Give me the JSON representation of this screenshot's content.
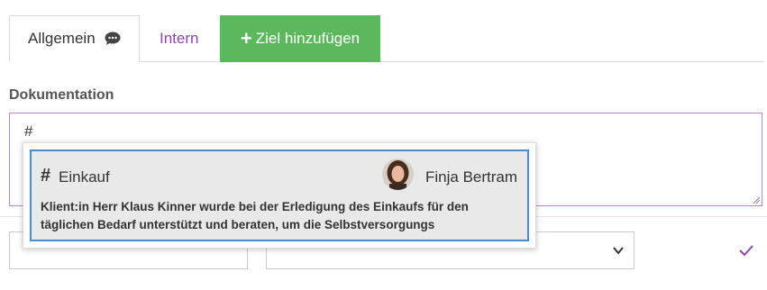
{
  "tabs": {
    "general": "Allgemein",
    "internal": "Intern",
    "add_goal": "Ziel hinzufügen",
    "add_symbol": "+"
  },
  "documentation": {
    "label": "Dokumentation",
    "value": "#"
  },
  "suggestion": {
    "hash": "#",
    "tag": "Einkauf",
    "user": "Finja Bertram",
    "text": "Klient:in Herr Klaus Kinner wurde bei der Erledigung des Einkaufs für den täglichen Bedarf unterstützt und beraten, um die Selbstversorgungs"
  },
  "colors": {
    "accent_purple": "#8e44ad",
    "success_green": "#5cb85c",
    "selection_blue": "#4a8bcc"
  },
  "icons": {
    "general_tab": "chat-bubble-icon",
    "dropdown": "chevron-down-icon",
    "confirm": "checkmark-icon"
  }
}
